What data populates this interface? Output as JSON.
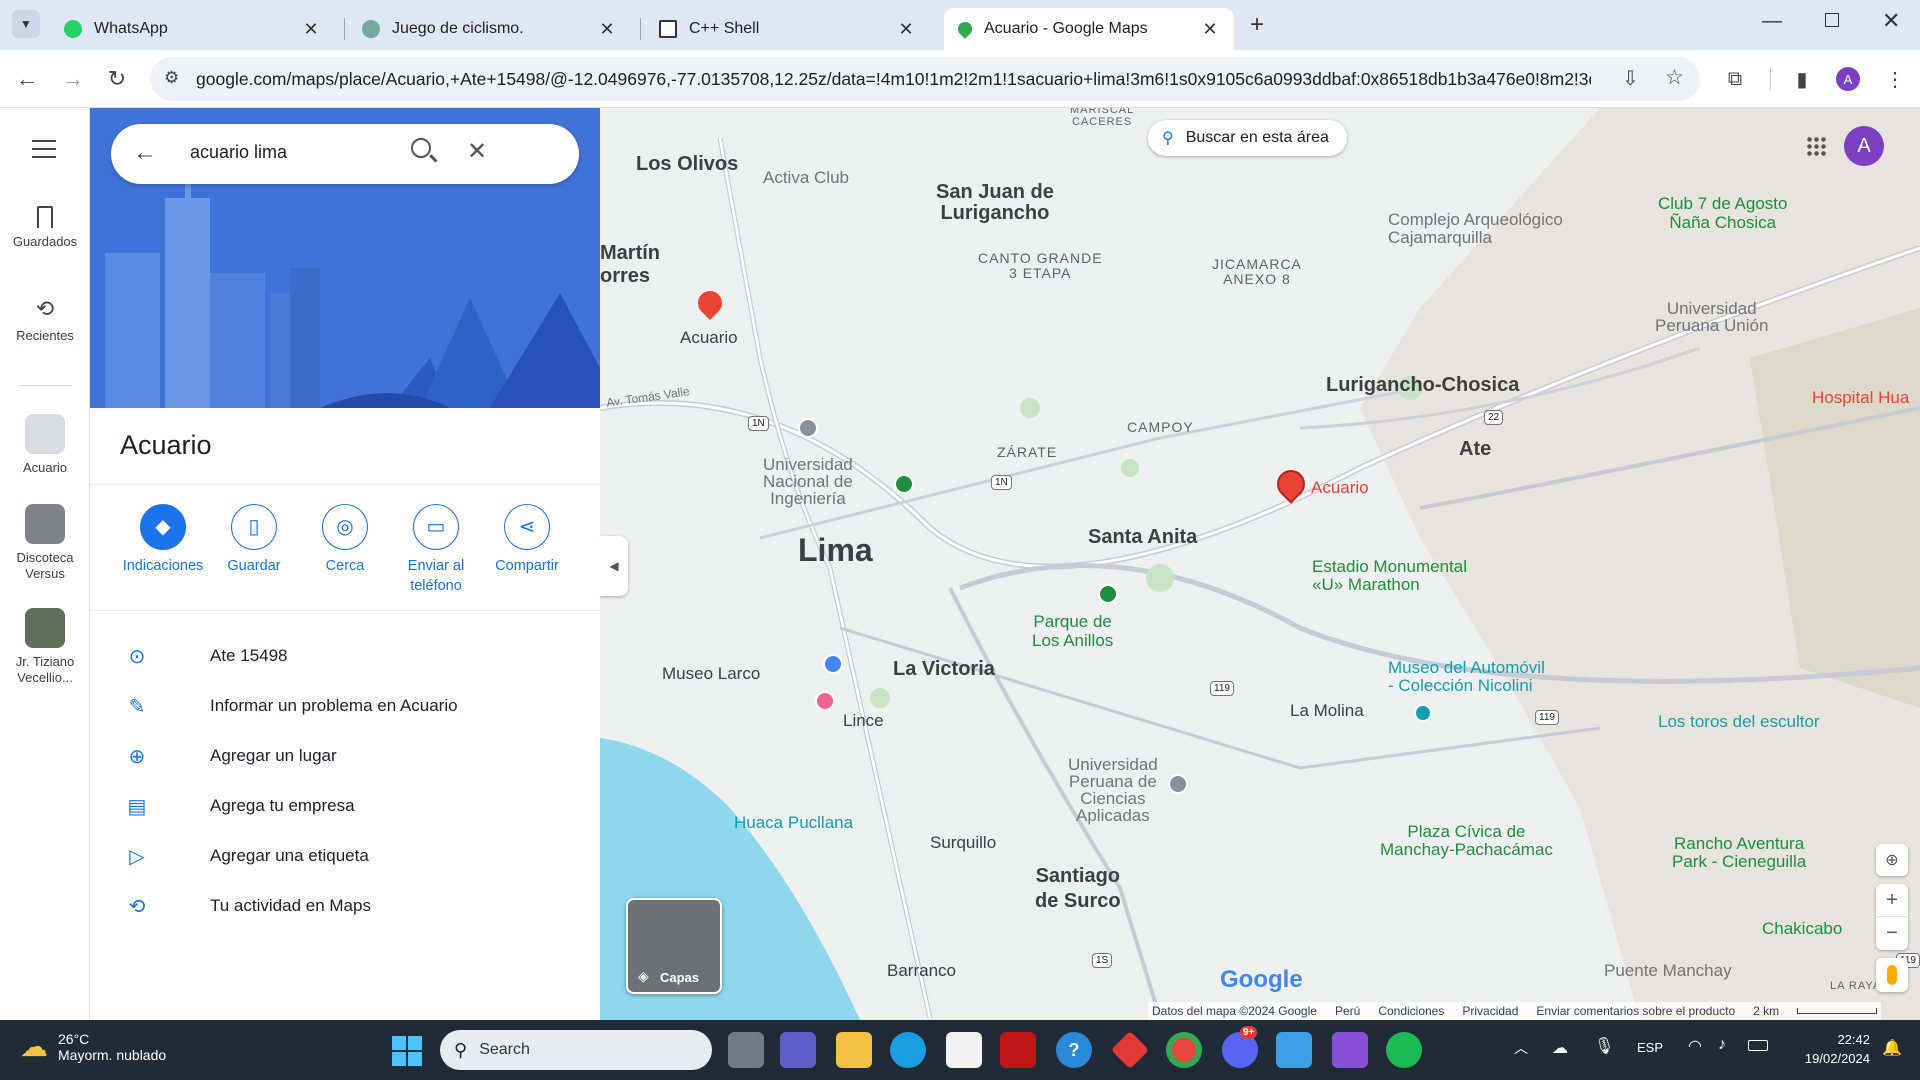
{
  "browser": {
    "tabs": [
      {
        "title": "WhatsApp",
        "favicon_color": "#25d366"
      },
      {
        "title": "Juego de ciclismo.",
        "favicon_color": "#74aa9c"
      },
      {
        "title": "C++ Shell",
        "favicon_color": "#333333"
      },
      {
        "title": "Acuario - Google Maps",
        "favicon_color": "#34a853"
      }
    ],
    "url": "google.com/maps/place/Acuario,+Ate+15498/@-12.0496976,-77.0135708,12.25z/data=!4m10!1m2!2m1!1sacuario+lima!3m6!1s0x9105c6a0993ddbaf:0x86518db1b3a476e0!8m2!3d-...",
    "profile_initial": "A"
  },
  "rail": {
    "saved": "Guardados",
    "recent": "Recientes",
    "history": [
      "Acuario",
      "Discoteca Versus",
      "Jr. Tiziano Vecellio..."
    ]
  },
  "panel": {
    "search_query": "acuario lima",
    "place_name": "Acuario",
    "actions": [
      "Indicaciones",
      "Guardar",
      "Cerca",
      "Enviar al teléfono",
      "Compartir"
    ],
    "rows": [
      "Ate 15498",
      "Informar un problema en Acuario",
      "Agregar un lugar",
      "Agrega tu empresa",
      "Agregar una etiqueta",
      "Tu actividad en Maps"
    ]
  },
  "map": {
    "search_area": "Buscar en esta área",
    "layers": "Capas",
    "avatar": "A",
    "labels": {
      "los_olivos": "Los Olivos",
      "activa_club": "Activa Club",
      "sjl": "San Juan de\nLurigancho",
      "martin": "Martín\norres",
      "acuario_pin": "Acuario",
      "canto_grande": "CANTO GRANDE\n3 ETAPA",
      "jicamarca": "JICAMARCA\nANEXO 8",
      "complejo": "Complejo Arqueológico\nCajamarquilla",
      "club7": "Club 7 de Agosto\nÑaña Chosica",
      "upeu": "Universidad\nPeruana Unión",
      "lurigancho": "Lurigancho-Chosica",
      "hospital": "Hospital Hua",
      "ate": "Ate",
      "campoy": "CAMPOY",
      "zarate": "ZÁRATE",
      "uni": "Universidad\nNacional de\nIngeniería",
      "tomas_valle": "Av. Tomás Valle",
      "lima": "Lima",
      "santa_anita": "Santa Anita",
      "acuario_red": "Acuario",
      "estadio": "Estadio Monumental\n«U» Marathon",
      "parque": "Parque de\nLos Anillos",
      "museo_larco": "Museo Larco",
      "la_victoria": "La Victoria",
      "lince": "Lince",
      "museo_auto": "Museo del Automóvil\n- Colección Nicolini",
      "la_molina": "La Molina",
      "toros": "Los toros del escultor",
      "upc": "Universidad\nPeruana de\nCiencias\nAplicadas",
      "huaca": "Huaca Pucllana",
      "surquillo": "Surquillo",
      "plaza": "Plaza Cívica de\nManchay-Pachacámac",
      "rancho": "Rancho Aventura\nPark - Cieneguilla",
      "santiago": "Santiago\nde Surco",
      "barranco": "Barranco",
      "chakicabo": "Chakicabo",
      "puente": "Puente Manchay",
      "la_raya": "LA RAYA",
      "caceres": "MARISCAL\nCACERES"
    },
    "shields": [
      "1N",
      "1N",
      "22",
      "119",
      "119",
      "1S",
      "119"
    ],
    "footer": [
      "Datos del mapa ©2024 Google",
      "Perú",
      "Condiciones",
      "Privacidad",
      "Enviar comentarios sobre el producto",
      "2 km"
    ],
    "google": "Google"
  },
  "taskbar": {
    "temp": "26°C",
    "weather": "Mayorm. nublado",
    "search": "Search",
    "lang": "ESP",
    "time": "22:42",
    "date": "19/02/2024",
    "discord_badge": "9+"
  },
  "colors": {
    "accent": "#1a73e8",
    "hero": "#3f73d8",
    "pin_red": "#ea4335",
    "taskbar": "#1f2b36"
  }
}
